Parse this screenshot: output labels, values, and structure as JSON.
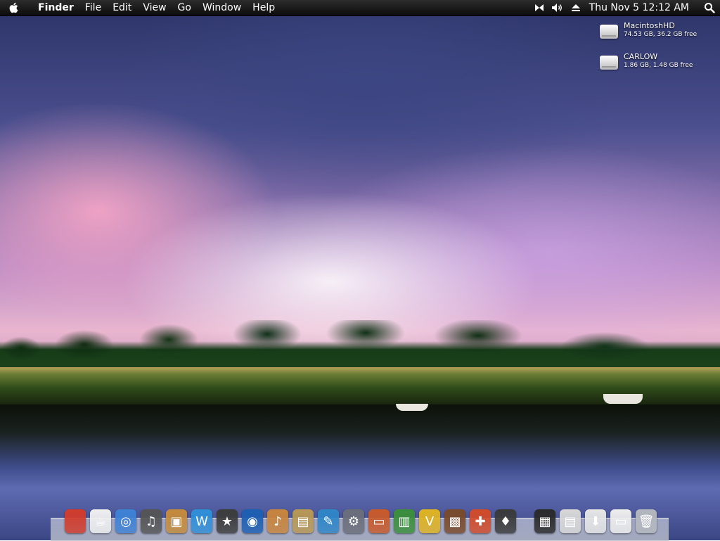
{
  "menubar": {
    "app_name": "Finder",
    "items": [
      "File",
      "Edit",
      "View",
      "Go",
      "Window",
      "Help"
    ],
    "status_icons": [
      "bluetooth-icon",
      "volume-icon",
      "eject-icon"
    ],
    "clock": "Thu Nov 5  12:12 AM",
    "spotlight_icon": "magnifier-icon"
  },
  "desktop": {
    "drives": [
      {
        "name": "MacintoshHD",
        "info": "74.53 GB, 36.2 GB free"
      },
      {
        "name": "CARLOW",
        "info": "1.86 GB, 1.48 GB free"
      }
    ]
  },
  "dock": {
    "apps": [
      {
        "icon": "apple-icon",
        "color": "#d23b2b",
        "glyph": ""
      },
      {
        "icon": "coffee-cup-icon",
        "color": "#f0f0f0",
        "glyph": "☕"
      },
      {
        "icon": "safari-compass-icon",
        "color": "#3e82d6",
        "glyph": "◎"
      },
      {
        "icon": "headphones-icon",
        "color": "#555555",
        "glyph": "♫"
      },
      {
        "icon": "iphoto-icon",
        "color": "#c68b3b",
        "glyph": "▣"
      },
      {
        "icon": "wave-w-icon",
        "color": "#2f8fd8",
        "glyph": "W"
      },
      {
        "icon": "imovie-star-icon",
        "color": "#3c3c3c",
        "glyph": "★"
      },
      {
        "icon": "dvd-icon",
        "color": "#1c5fb3",
        "glyph": "◉"
      },
      {
        "icon": "garageband-guitar-icon",
        "color": "#c9853c",
        "glyph": "♪"
      },
      {
        "icon": "preview-icon",
        "color": "#b89955",
        "glyph": "▤"
      },
      {
        "icon": "feather-icon",
        "color": "#2f86c8",
        "glyph": "✎"
      },
      {
        "icon": "system-preferences-icon",
        "color": "#6b6e7a",
        "glyph": "⚙"
      },
      {
        "icon": "keynote-icon",
        "color": "#c95a2a",
        "glyph": "▭"
      },
      {
        "icon": "numbers-chart-icon",
        "color": "#3b8f3b",
        "glyph": "▥"
      },
      {
        "icon": "yellow-v-icon",
        "color": "#e0b422",
        "glyph": "V"
      },
      {
        "icon": "stuffit-box-icon",
        "color": "#7a4a2a",
        "glyph": "▩"
      },
      {
        "icon": "launcher-icon",
        "color": "#d24b2a",
        "glyph": "✚"
      },
      {
        "icon": "lamp-icon",
        "color": "#3a3a3a",
        "glyph": "♦"
      }
    ],
    "stacks": [
      {
        "icon": "clapperboard-icon",
        "color": "#2a2a2a",
        "glyph": "▦"
      },
      {
        "icon": "stuff-folder-icon",
        "color": "#d8d8d8",
        "glyph": "▤"
      },
      {
        "icon": "downloads-folder-icon",
        "color": "#e6e6e6",
        "glyph": "⬇"
      },
      {
        "icon": "document-stack-icon",
        "color": "#eeeeee",
        "glyph": "▭"
      },
      {
        "icon": "trash-icon",
        "color": "#b4b8bf",
        "glyph": "🗑"
      }
    ]
  }
}
